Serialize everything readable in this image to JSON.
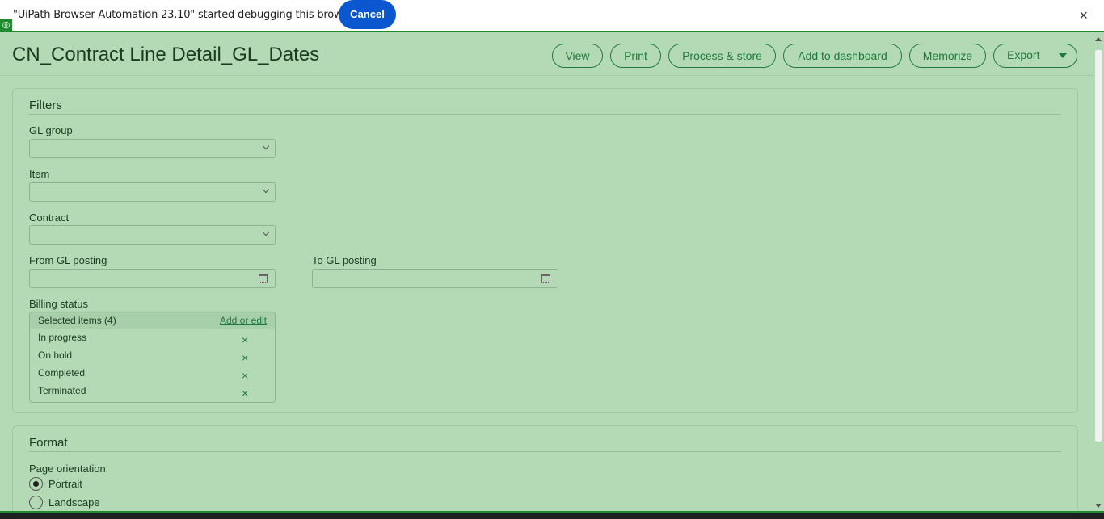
{
  "infobar": {
    "message": "\"UiPath Browser Automation 23.10\" started debugging this browser",
    "cancel_label": "Cancel",
    "close_icon": "×"
  },
  "header": {
    "title": "CN_Contract Line Detail_GL_Dates",
    "buttons": {
      "view": "View",
      "print": "Print",
      "process_store": "Process & store",
      "add_dashboard": "Add to dashboard",
      "memorize": "Memorize",
      "export": "Export"
    }
  },
  "filters": {
    "title": "Filters",
    "gl_group_label": "GL group",
    "gl_group_value": "",
    "item_label": "Item",
    "item_value": "",
    "contract_label": "Contract",
    "contract_value": "",
    "from_gl_label": "From GL posting",
    "from_gl_value": "",
    "to_gl_label": "To GL posting",
    "to_gl_value": "",
    "billing_label": "Billing status",
    "billing_selected": "Selected items (4)",
    "billing_add": "Add or edit",
    "billing_items": [
      "In progress",
      "On hold",
      "Completed",
      "Terminated"
    ],
    "remove_icon": "×"
  },
  "format": {
    "title": "Format",
    "orientation_label": "Page orientation",
    "options": [
      "Portrait",
      "Landscape"
    ],
    "selected": "Portrait"
  },
  "colors": {
    "background": "#b3dab5",
    "accent": "#1f7a3a",
    "cancel_button": "#0b57d0"
  }
}
